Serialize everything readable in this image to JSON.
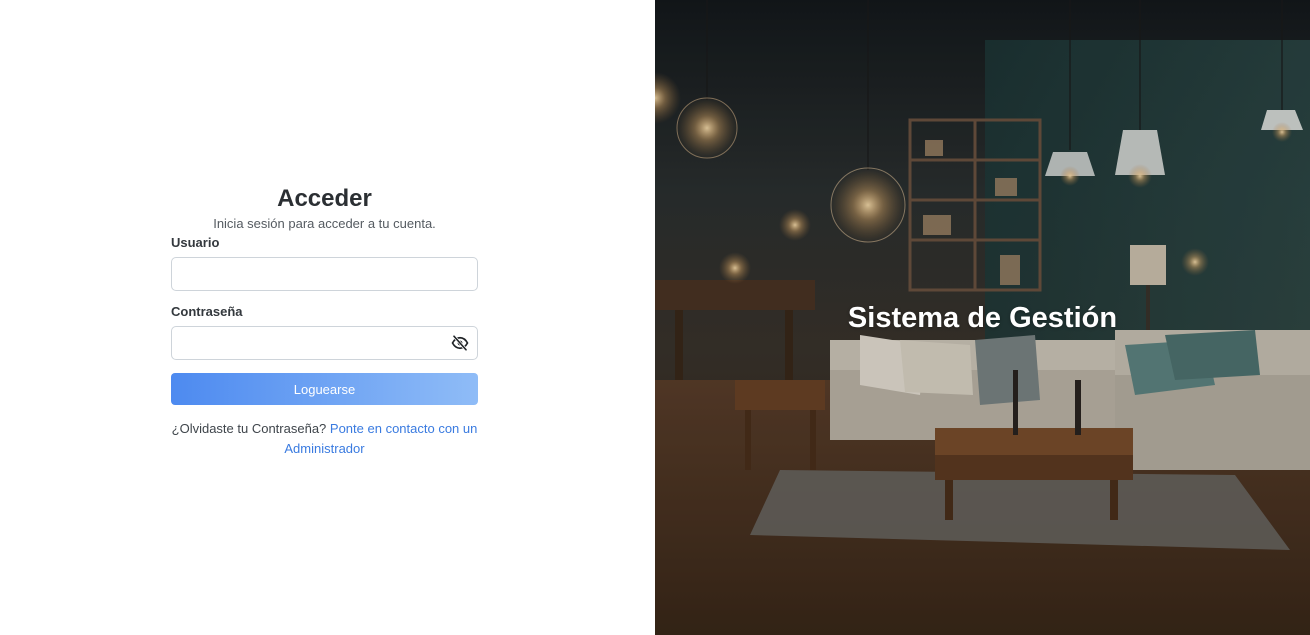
{
  "login": {
    "title": "Acceder",
    "subtitle": "Inicia sesión para acceder a tu cuenta.",
    "username_label": "Usuario",
    "username_value": "",
    "password_label": "Contraseña",
    "password_value": "",
    "submit_label": "Loguearse",
    "forgot_text": "¿Olvidaste tu Contraseña?",
    "forgot_link": "Ponte en contacto con un Administrador"
  },
  "hero": {
    "title": "Sistema de Gestión"
  },
  "colors": {
    "primary_button_start": "#4d8af0",
    "primary_button_end": "#8fbcf7",
    "link": "#3a7be0"
  },
  "icons": {
    "password_toggle": "eye-slash-icon"
  }
}
